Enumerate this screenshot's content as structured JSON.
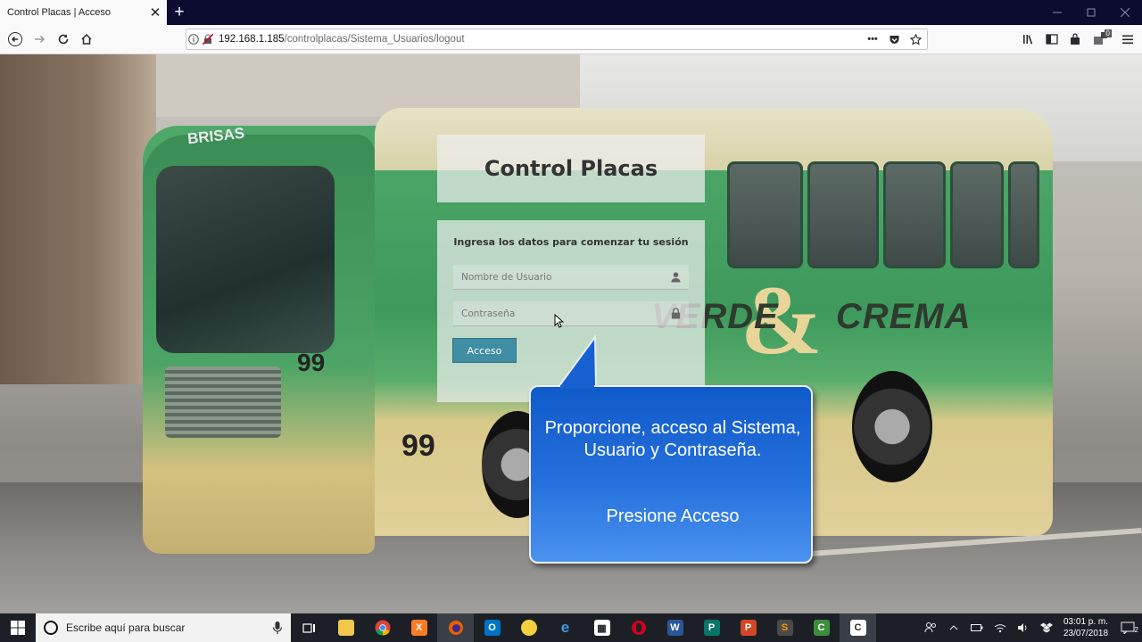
{
  "browser": {
    "tab_title": "Control Placas | Acceso",
    "tab_close": "✕",
    "new_tab": "+",
    "url_host": "192.168.1.185",
    "url_path": "/controlplacas/Sistema_Usuarios/logout",
    "page_actions": "•••",
    "toolbar_badge": "0"
  },
  "login": {
    "title": "Control Placas",
    "message": "Ingresa los datos para comenzar tu sesión",
    "username_placeholder": "Nombre de Usuario",
    "password_placeholder": "Contraseña",
    "submit_label": "Acceso"
  },
  "callout": {
    "line1": "Proporcione, acceso al Sistema, Usuario y Contraseña.",
    "line2": "Presione Acceso"
  },
  "scene": {
    "bus_brand": "VERDE",
    "bus_brand2": "CREMA",
    "bus_brand_amp": "&",
    "bus_number": "99",
    "bus_sign": "BRISAS"
  },
  "taskbar": {
    "search_placeholder": "Escribe aquí para buscar",
    "time": "03:01 p. m.",
    "date": "23/07/2018",
    "notification_count": "2"
  },
  "colors": {
    "accent_button": "#3f8ea3",
    "callout_blue": "#1f66d6",
    "taskbar": "#1c2026",
    "tabstrip": "#0c0c30"
  }
}
